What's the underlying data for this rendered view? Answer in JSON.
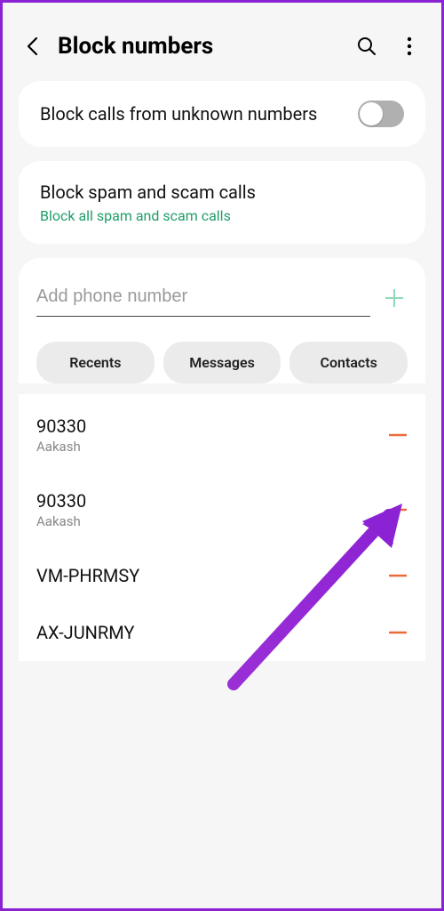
{
  "header": {
    "title": "Block numbers"
  },
  "card_unknown": {
    "title": "Block calls from unknown numbers"
  },
  "card_spam": {
    "title": "Block spam and scam calls",
    "subtitle": "Block all spam and scam calls"
  },
  "input": {
    "placeholder": "Add phone number"
  },
  "tabs": {
    "recents": "Recents",
    "messages": "Messages",
    "contacts": "Contacts"
  },
  "blocked_list": [
    {
      "number": "90330",
      "name": "Aakash"
    },
    {
      "number": "90330",
      "name": "Aakash"
    },
    {
      "number": "VM-PHRMSY",
      "name": ""
    },
    {
      "number": "AX-JUNRMY",
      "name": ""
    }
  ]
}
